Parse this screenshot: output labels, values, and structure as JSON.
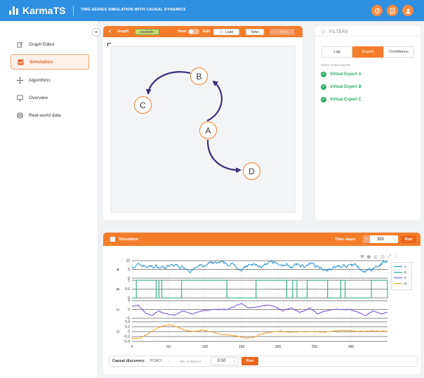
{
  "app": {
    "brand": "KarmaTS",
    "tagline": "TIME-SERIES SIMULATION WITH CAUSAL DYNAMICS"
  },
  "topbar_icons": [
    "github-icon",
    "document-icon",
    "user-icon"
  ],
  "colors": {
    "primary": "#2f8fe0",
    "accent": "#f47d2c",
    "edge": "#3a2f78",
    "node_border": "#f47d2c",
    "success": "#2fae6a"
  },
  "sidebar": {
    "items": [
      {
        "label": "Graph Editor",
        "icon": "edit-icon"
      },
      {
        "label": "Simulation",
        "icon": "chart-icon",
        "active": true
      },
      {
        "label": "Algorithms",
        "icon": "move-icon"
      },
      {
        "label": "Overview",
        "icon": "monitor-icon"
      },
      {
        "label": "Real-world data",
        "icon": "database-icon"
      }
    ]
  },
  "graph_panel": {
    "title": "Graph",
    "badge": "example",
    "view_label": "View",
    "edit_label": "Edit",
    "load_label": "Load",
    "new_label": "New",
    "save_label": "Save",
    "nodes": [
      "A",
      "B",
      "C",
      "D"
    ],
    "edges": [
      [
        "A",
        "B"
      ],
      [
        "B",
        "C"
      ],
      [
        "A",
        "D"
      ]
    ]
  },
  "filters": {
    "title": "FILTERS",
    "tabs": [
      "Lag",
      "Expert",
      "Confidence"
    ],
    "active_tab": "Expert",
    "hint": "Select virtual experts",
    "experts": [
      "Virtual Expert A",
      "Virtual Expert B",
      "Virtual Expert C"
    ]
  },
  "simulation": {
    "title": "Simulation",
    "time_steps_label": "Time steps:",
    "time_steps_value": "350",
    "minus_label": "−",
    "plus_label": "+",
    "run_label": "Run"
  },
  "causal": {
    "label": "Causal discovery:",
    "method": "PCMCI",
    "min_conf_label": "Min confidence",
    "min_conf_value": "0.50",
    "run_label": "Run"
  },
  "chart_data": {
    "type": "line",
    "x_ticks": [
      "0",
      "50",
      "100",
      "150",
      "200",
      "250",
      "300"
    ],
    "x_range": [
      0,
      350
    ],
    "panels": [
      {
        "name": "A",
        "ylabel": "A",
        "yticks": [
          "10",
          "5",
          "0"
        ],
        "ylim": [
          0,
          12
        ],
        "color": "#1f8fd6"
      },
      {
        "name": "B",
        "ylabel": "B",
        "yticks": [
          "1",
          "0.5",
          "0"
        ],
        "ylim": [
          0,
          1
        ],
        "color": "#18a67a"
      },
      {
        "name": "C",
        "ylabel": "C",
        "yticks": [
          "5",
          "0",
          "−5"
        ],
        "ylim": [
          -6,
          6
        ],
        "color": "#7b4fdc"
      },
      {
        "name": "D",
        "ylabel": "D",
        "yticks": [
          "0.4",
          "0.2",
          "0",
          "−0.2",
          "−0.4"
        ],
        "ylim": [
          -0.45,
          0.45
        ],
        "color": "#f0a020"
      }
    ],
    "legend": [
      "A",
      "B",
      "C",
      "D"
    ],
    "legend_position": "right",
    "grid": true,
    "b_high_intervals": [
      [
        6,
        33
      ],
      [
        37,
        41
      ],
      [
        68,
        130
      ],
      [
        170,
        212
      ],
      [
        220,
        226
      ],
      [
        240,
        268
      ],
      [
        286,
        292
      ],
      [
        328,
        350
      ]
    ],
    "c_anchors": [
      [
        0,
        2
      ],
      [
        8,
        3
      ],
      [
        14,
        0
      ],
      [
        20,
        -3
      ],
      [
        28,
        -4
      ],
      [
        36,
        -1
      ],
      [
        46,
        -3
      ],
      [
        58,
        -4
      ],
      [
        70,
        -1
      ],
      [
        82,
        -3
      ],
      [
        96,
        -1
      ],
      [
        110,
        0
      ],
      [
        130,
        0
      ],
      [
        140,
        2
      ],
      [
        150,
        4
      ],
      [
        160,
        1
      ],
      [
        174,
        2
      ],
      [
        186,
        3
      ],
      [
        196,
        2
      ],
      [
        206,
        -1
      ],
      [
        218,
        1
      ],
      [
        230,
        -2
      ],
      [
        244,
        1
      ],
      [
        254,
        -3
      ],
      [
        264,
        -1
      ],
      [
        276,
        0
      ],
      [
        300,
        0
      ],
      [
        310,
        -2
      ],
      [
        320,
        -4
      ],
      [
        330,
        -1
      ],
      [
        342,
        -3
      ],
      [
        350,
        -2
      ]
    ],
    "d_anchors": [
      [
        0,
        -0.3
      ],
      [
        10,
        -0.32
      ],
      [
        22,
        -0.1
      ],
      [
        34,
        0.15
      ],
      [
        44,
        0.27
      ],
      [
        52,
        0.32
      ],
      [
        62,
        0.2
      ],
      [
        74,
        0.05
      ],
      [
        86,
        0.0
      ],
      [
        96,
        0.07
      ],
      [
        108,
        0.0
      ],
      [
        120,
        -0.12
      ],
      [
        132,
        -0.15
      ],
      [
        144,
        -0.2
      ],
      [
        154,
        -0.3
      ],
      [
        166,
        -0.27
      ],
      [
        176,
        -0.12
      ],
      [
        190,
        -0.02
      ],
      [
        204,
        0.02
      ],
      [
        216,
        -0.03
      ],
      [
        228,
        0.0
      ],
      [
        240,
        -0.01
      ],
      [
        252,
        0.0
      ],
      [
        264,
        -0.03
      ],
      [
        276,
        0.03
      ],
      [
        290,
        0.05
      ],
      [
        302,
        0.03
      ],
      [
        314,
        0.01
      ],
      [
        326,
        0.03
      ],
      [
        340,
        0.02
      ],
      [
        350,
        0.02
      ]
    ]
  }
}
